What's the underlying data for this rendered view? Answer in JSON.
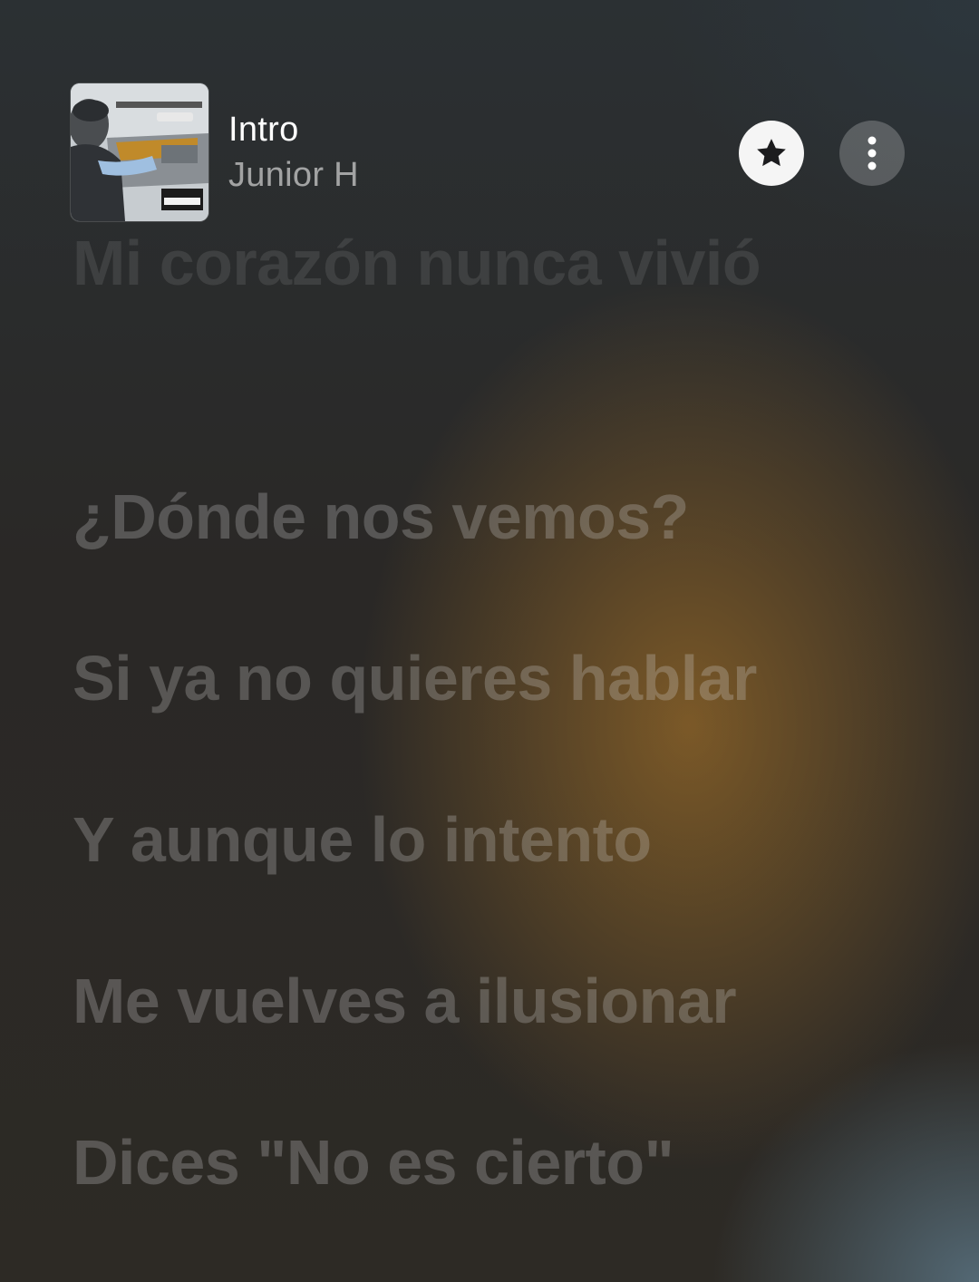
{
  "now_playing": {
    "title": "Intro",
    "artist": "Junior H",
    "artwork": {
      "icon": "album-artwork",
      "text_top": "CRUISIN' WITH JUNIOR H",
      "badge": "PARENTAL ADVISORY EXPLICIT CONTENT"
    },
    "favorite_icon": "star-icon",
    "more_icon": "more-vertical-icon"
  },
  "lyrics": [
    "Mi corazón nunca vivió",
    "¿Dónde nos vemos?",
    "Si ya no quieres hablar",
    "Y aunque lo intento",
    "Me vuelves a ilusionar",
    "Dices \"No es cierto\""
  ]
}
